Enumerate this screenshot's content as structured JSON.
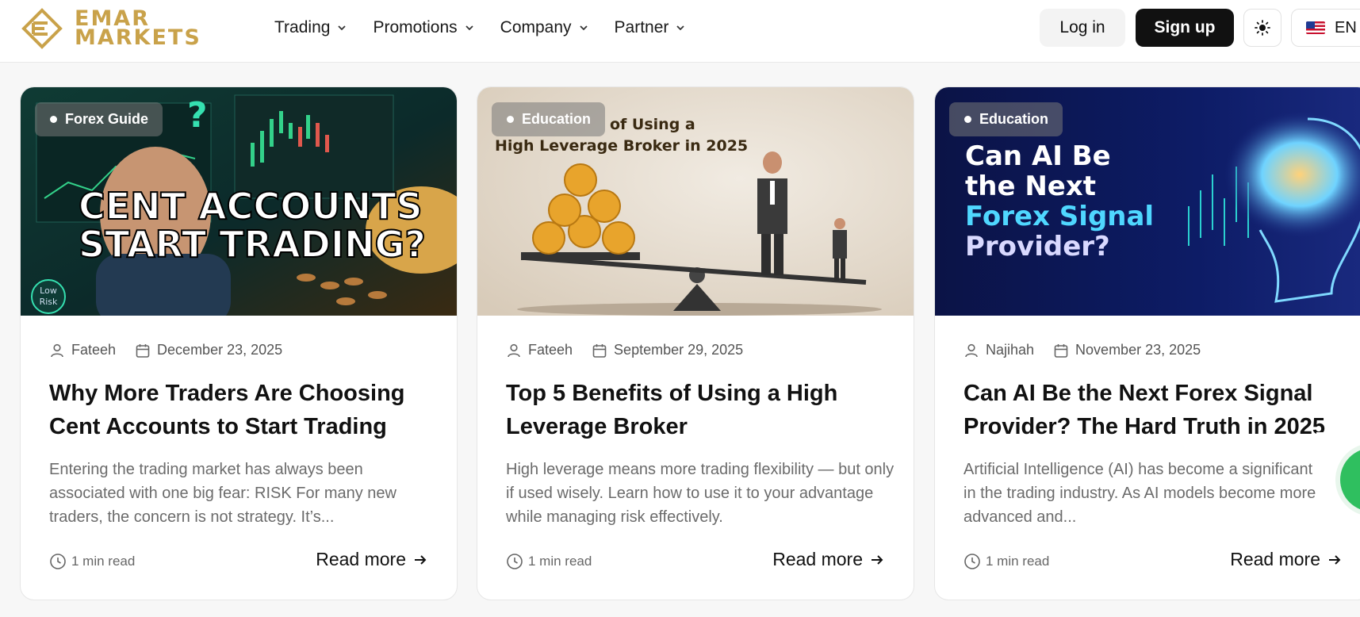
{
  "brand": {
    "line1": "EMAR",
    "line2": "MARKETS",
    "color": "#c9a24a"
  },
  "nav": {
    "menu": [
      {
        "label": "Trading"
      },
      {
        "label": "Promotions"
      },
      {
        "label": "Company"
      },
      {
        "label": "Partner"
      }
    ],
    "login_label": "Log in",
    "signup_label": "Sign up",
    "language": "EN",
    "theme_icon": "sun-icon"
  },
  "cards": [
    {
      "tag": "Forex Guide",
      "image_text": [
        "CENT ACCOUNTS",
        "START TRADING?"
      ],
      "image_badge": [
        "Low",
        "Risk"
      ],
      "author": "Fateeh",
      "date": "December 23, 2025",
      "title": "Why More Traders Are Choosing Cent Accounts to Start Trading",
      "excerpt": "Entering the trading market has always been associated with one big fear: RISK For many new traders, the concern is not strategy. It’s...",
      "read_time": "1 min read",
      "read_more": "Read more"
    },
    {
      "tag": "Education",
      "image_text": [
        "of Using a",
        "High Leverage Broker in 2025"
      ],
      "author": "Fateeh",
      "date": "September 29, 2025",
      "title": "Top 5 Benefits of Using a High Leverage Broker",
      "excerpt": "High leverage means more trading flexibility — but only if used wisely. Learn how to use it to your advantage while managing risk effectively.",
      "read_time": "1 min read",
      "read_more": "Read more"
    },
    {
      "tag": "Education",
      "image_text": [
        "Can AI Be",
        "the Next",
        "Forex Signal",
        "Provider?"
      ],
      "author": "Najihah",
      "date": "November 23, 2025",
      "title": "Can AI Be the Next Forex Signal Provider? The Hard Truth in 2025",
      "excerpt": "Artificial Intelligence (AI) has become a significant topic in the trading industry. As AI models become more advanced and...",
      "read_time": "1 min read",
      "read_more": "Read more"
    }
  ],
  "colors": {
    "accent_gold": "#c9a24a",
    "signup_bg": "#111111",
    "chat_green": "#2fbf5f"
  }
}
